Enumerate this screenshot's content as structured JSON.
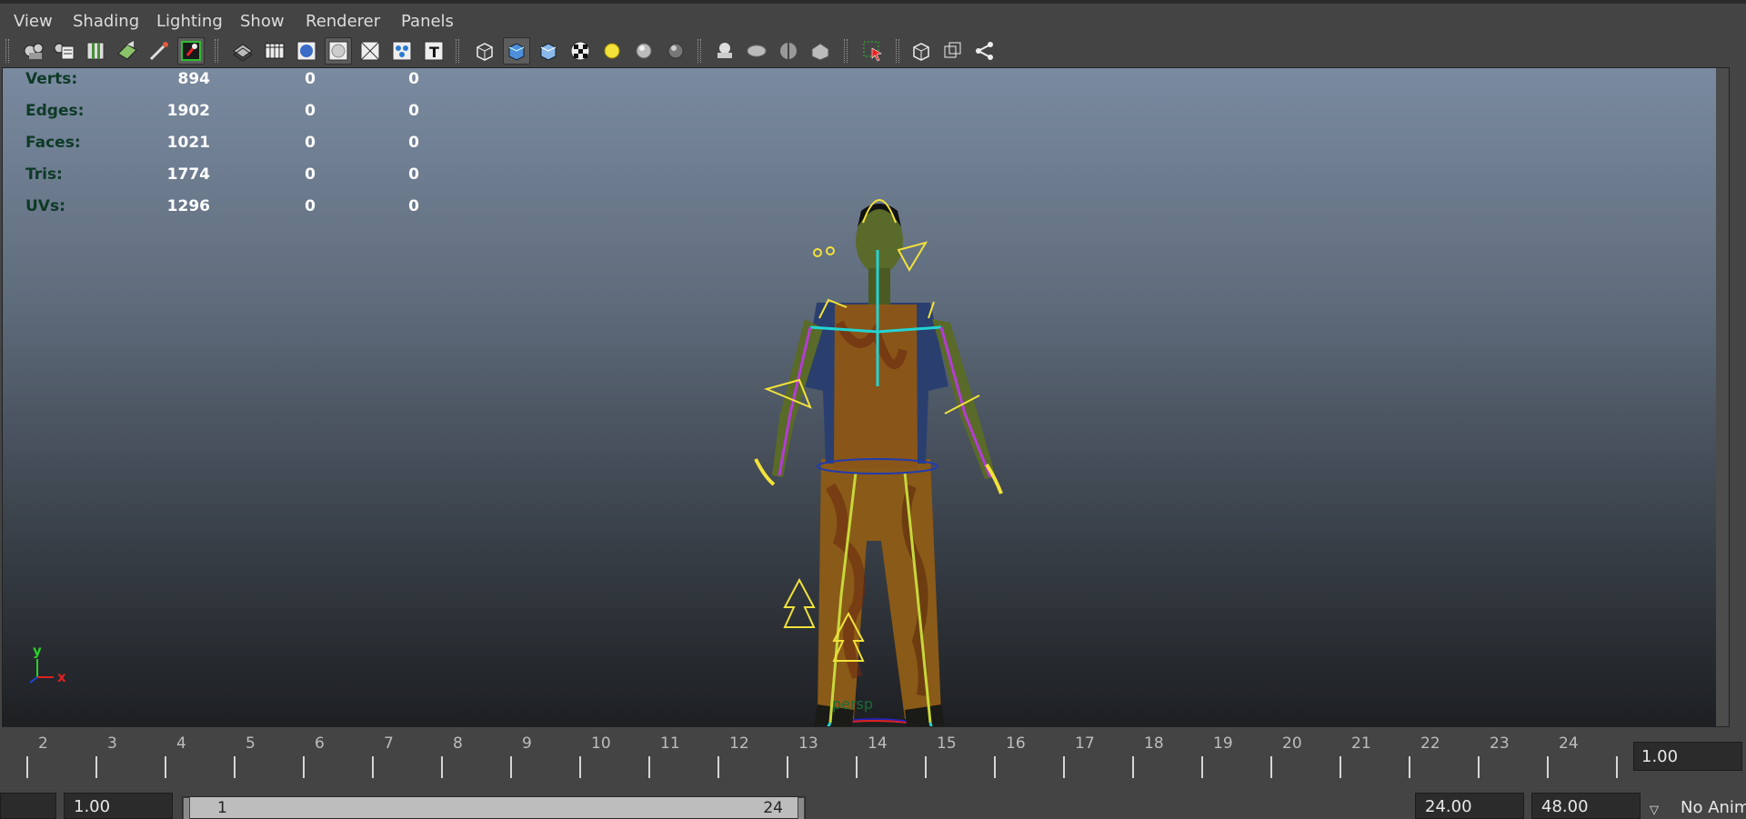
{
  "menu": {
    "items": [
      "View",
      "Shading",
      "Lighting",
      "Show",
      "Renderer",
      "Panels"
    ]
  },
  "toolbar": {
    "icons": [
      "camera-select-icon",
      "camera-attributes-icon",
      "bookmark-icon",
      "image-plane-icon",
      "grease-pencil-icon",
      "film-gate-icon",
      "wireframe-on-shaded-icon",
      "grid-icon",
      "smooth-shade-icon",
      "flat-shade-icon",
      "xray-icon",
      "xray-joints-icon",
      "texture-icon",
      "default-material-icon",
      "wireframe-cube-icon",
      "shaded-cube-icon",
      "textured-cube-icon",
      "checker-icon",
      "use-lights-icon",
      "shadows-icon",
      "ambient-occlusion-icon",
      "motion-blur-icon",
      "anti-alias-icon",
      "depth-of-field-icon",
      "hud-icon",
      "isolate-select-icon",
      "wireframe-mode-icon",
      "two-sided-lighting-icon",
      "joint-icon"
    ]
  },
  "hud": {
    "rows": [
      {
        "label": "Verts:",
        "v1": "894",
        "v2": "0",
        "v3": "0"
      },
      {
        "label": "Edges:",
        "v1": "1902",
        "v2": "0",
        "v3": "0"
      },
      {
        "label": "Faces:",
        "v1": "1021",
        "v2": "0",
        "v3": "0"
      },
      {
        "label": "Tris:",
        "v1": "1774",
        "v2": "0",
        "v3": "0"
      },
      {
        "label": "UVs:",
        "v1": "1296",
        "v2": "0",
        "v3": "0"
      }
    ]
  },
  "viewport": {
    "camera": "persp",
    "axis": {
      "y": "y",
      "x": "x"
    }
  },
  "timeline": {
    "frames": [
      "2",
      "3",
      "4",
      "5",
      "6",
      "7",
      "8",
      "9",
      "10",
      "11",
      "12",
      "13",
      "14",
      "15",
      "16",
      "17",
      "18",
      "19",
      "20",
      "21",
      "22",
      "23",
      "24"
    ],
    "current_time": "1.00"
  },
  "range": {
    "start_time": "1.00",
    "range_start": "1",
    "range_end": "24",
    "end_time": "24.00",
    "anim_end": "48.00",
    "anim_layer": "No Anim"
  },
  "colors": {
    "hud_label": "#0d3a26",
    "bg_top": "#7a8aa0",
    "bg_bottom": "#1d1f22"
  }
}
